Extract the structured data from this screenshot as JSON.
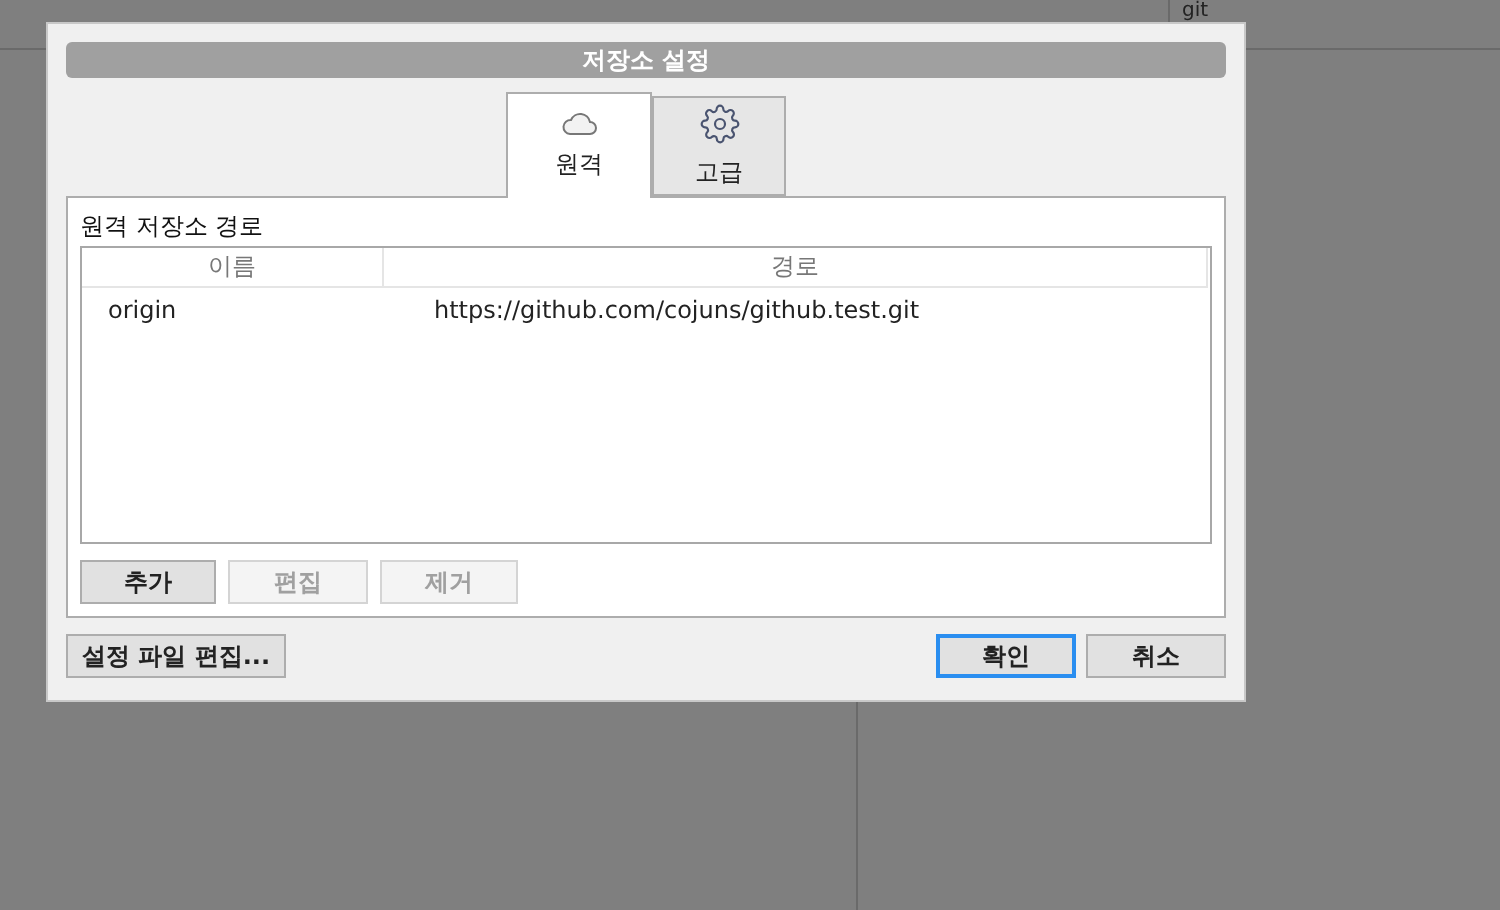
{
  "background": {
    "search_field": "git"
  },
  "dialog": {
    "title": "저장소 설정",
    "tabs": [
      {
        "label": "원격",
        "selected": true
      },
      {
        "label": "고급",
        "selected": false
      }
    ],
    "section_label": "원격 저장소 경로",
    "table": {
      "columns": [
        "이름",
        "경로"
      ],
      "rows": [
        {
          "name": "origin",
          "path": "https://github.com/cojuns/github.test.git"
        }
      ]
    },
    "list_buttons": [
      {
        "label": "추가",
        "disabled": false
      },
      {
        "label": "편집",
        "disabled": true
      },
      {
        "label": "제거",
        "disabled": true
      }
    ],
    "edit_config_button": "설정 파일 편집...",
    "footer_buttons": [
      {
        "label": "확인",
        "focused": true
      },
      {
        "label": "취소",
        "focused": false
      }
    ]
  }
}
